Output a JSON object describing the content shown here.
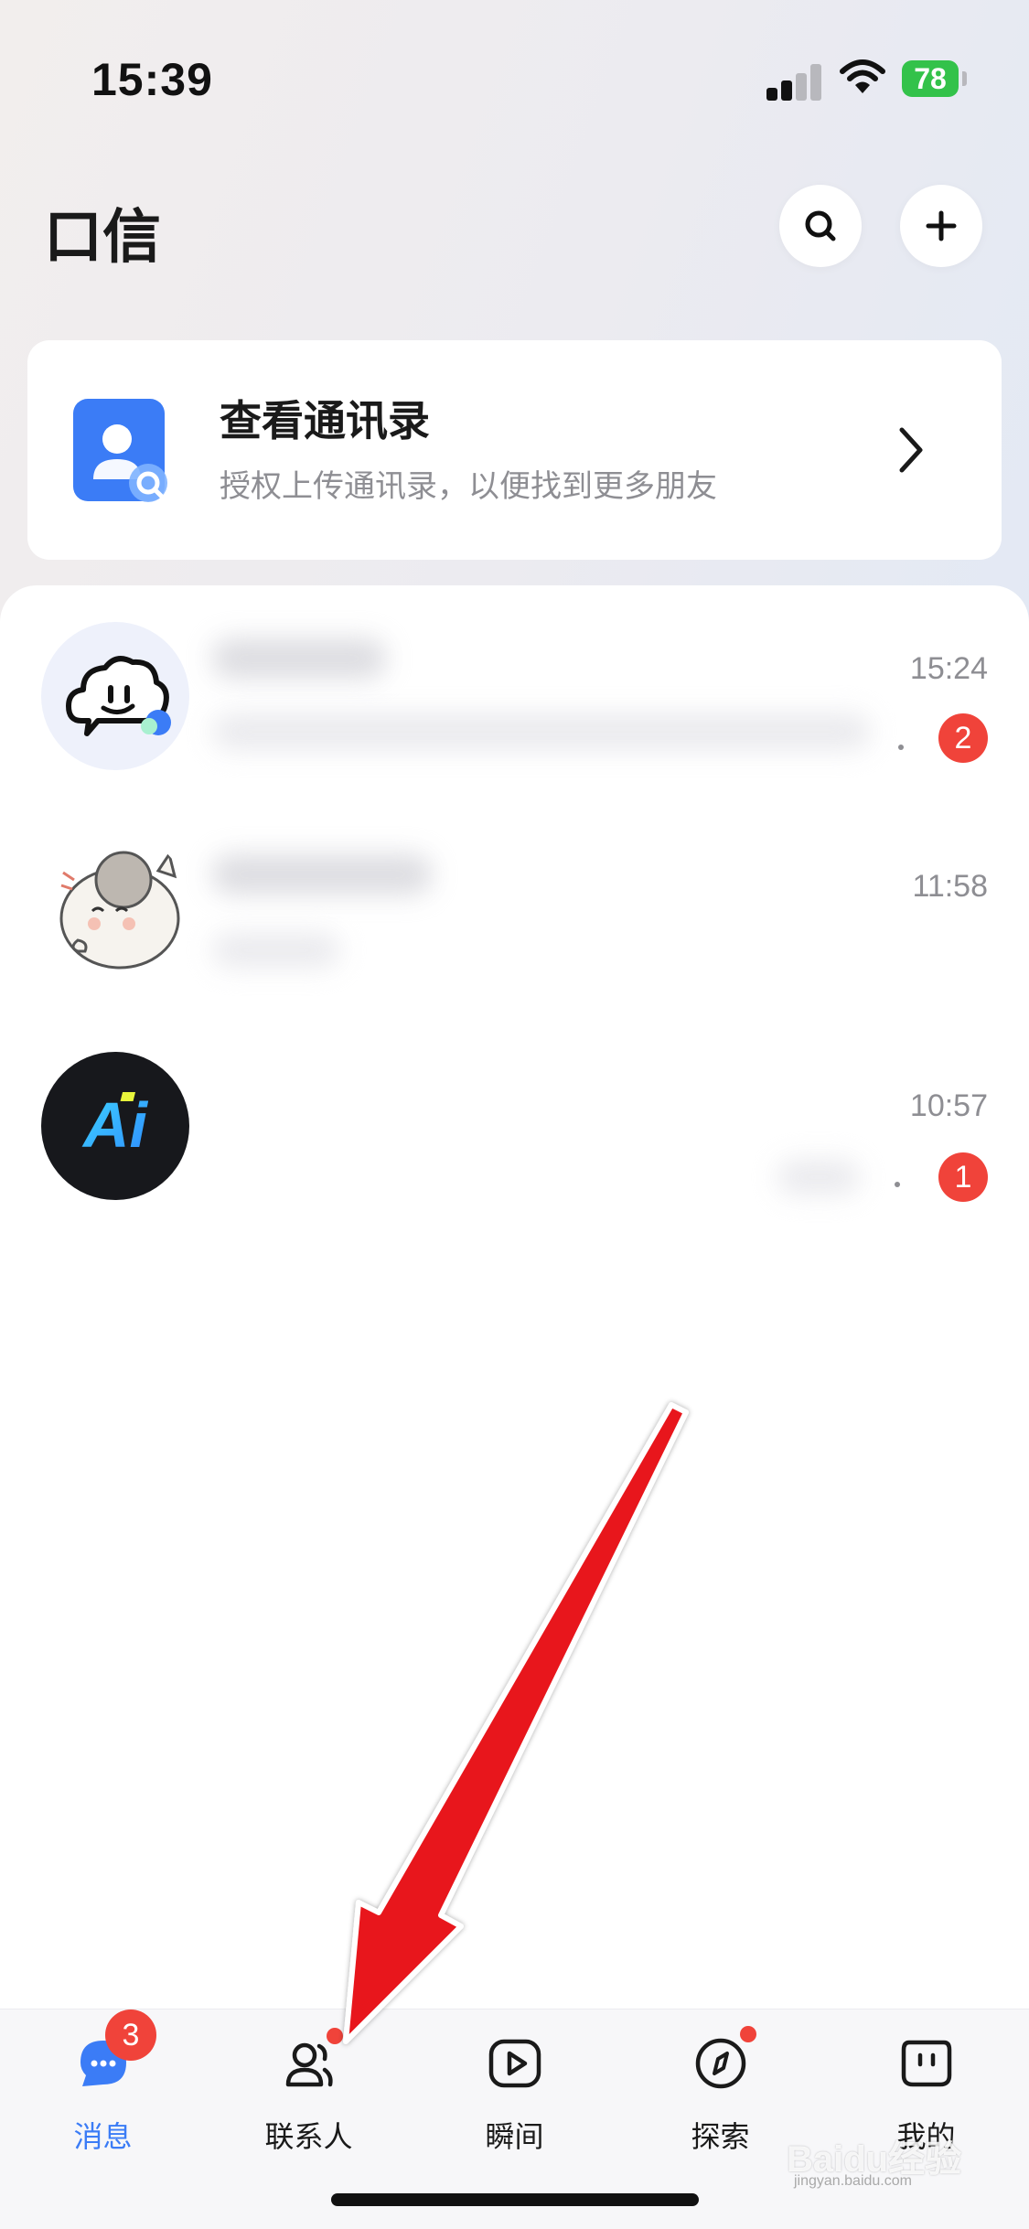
{
  "status_bar": {
    "time": "15:39",
    "battery": "78"
  },
  "header": {
    "title": "口信"
  },
  "contacts_card": {
    "title": "查看通讯录",
    "subtitle": "授权上传通讯录，以便找到更多朋友"
  },
  "chats": [
    {
      "time": "15:24",
      "unread": "2"
    },
    {
      "time": "11:58"
    },
    {
      "avatar_text": "Ai",
      "time": "10:57",
      "unread": "1"
    }
  ],
  "tabs": [
    {
      "label": "消息",
      "badge": "3",
      "icon": "message-bubble-icon"
    },
    {
      "label": "联系人",
      "icon": "contacts-icon"
    },
    {
      "label": "瞬间",
      "icon": "play-icon"
    },
    {
      "label": "探索",
      "icon": "compass-icon"
    },
    {
      "label": "我的",
      "icon": "profile-face-icon"
    }
  ],
  "watermark": {
    "brand": "Baidu经验",
    "url": "jingyan.baidu.com"
  },
  "colors": {
    "accent": "#3b7cf6",
    "badge": "#f0433a",
    "arrow": "#e8141a"
  }
}
